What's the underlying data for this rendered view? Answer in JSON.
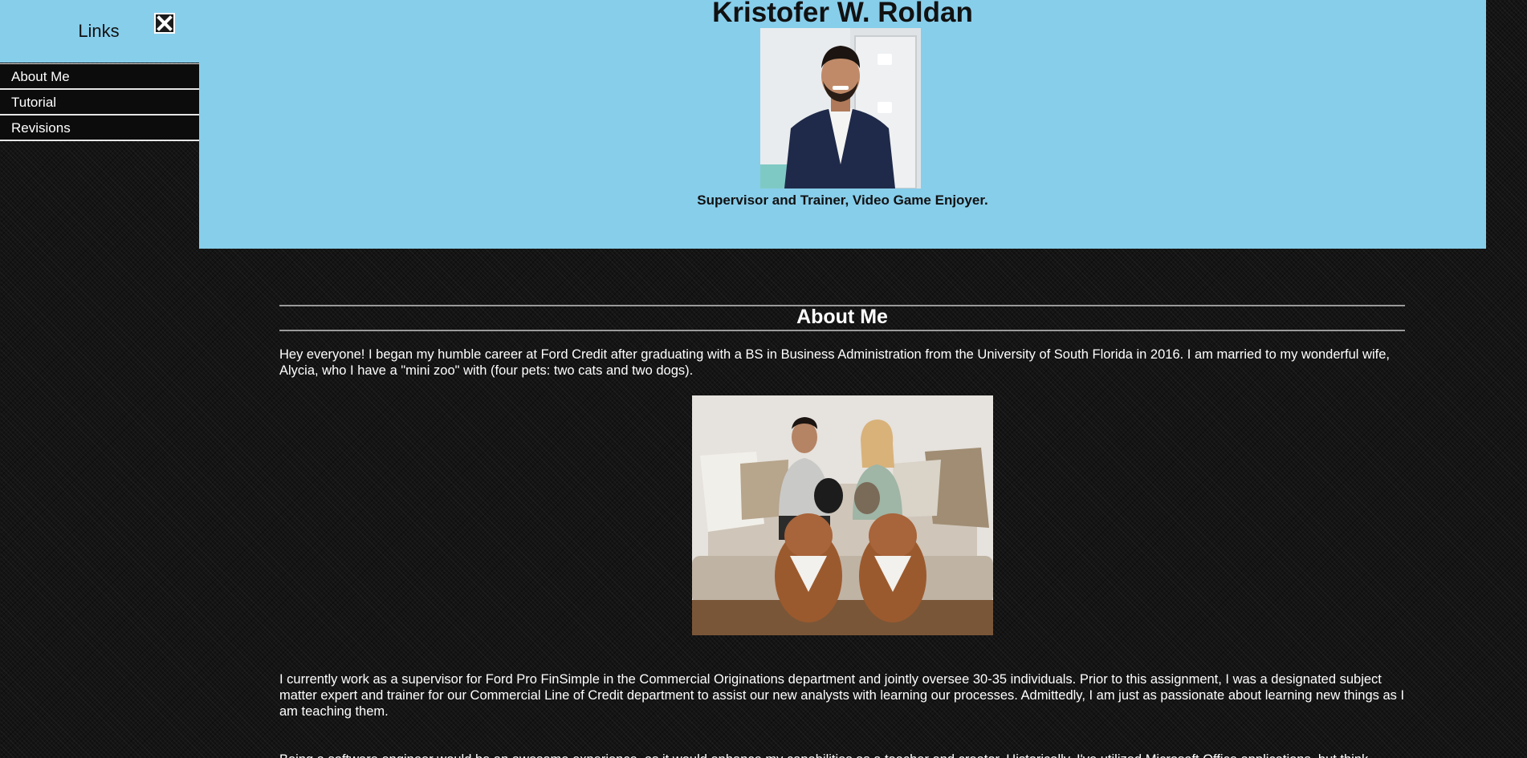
{
  "sidebar": {
    "title": "Links",
    "close_icon": "close-icon",
    "items": [
      {
        "label": "About Me"
      },
      {
        "label": "Tutorial"
      },
      {
        "label": "Revisions"
      }
    ]
  },
  "header": {
    "title": "Kristofer W. Roldan",
    "tagline": "Supervisor and Trainer, Video Game Enjoyer."
  },
  "about": {
    "heading": "About Me",
    "paragraphs": [
      "Hey everyone! I began my humble career at Ford Credit after graduating with a BS in Business Administration from the University of South Florida in 2016. I am married to my wonderful wife, Alycia, who I have a \"mini zoo\" with (four pets: two cats and two dogs).",
      "I currently work as a supervisor for Ford Pro FinSimple in the Commercial Originations department and jointly oversee 30-35 individuals. Prior to this assignment, I was a designated subject matter expert and trainer for our Commercial Line of Credit department to assist our new analysts with learning our processes. Admittedly, I am just as passionate about learning new things as I am teaching them.",
      "Being a software engineer would be an awesome experience, as it would enhance my capabilities as a teacher and creator. Historically, I've utilized Microsoft Office applications, but think"
    ]
  },
  "colors": {
    "header_bg": "#87ceeb",
    "page_bg": "#141414",
    "text": "#ffffff"
  }
}
